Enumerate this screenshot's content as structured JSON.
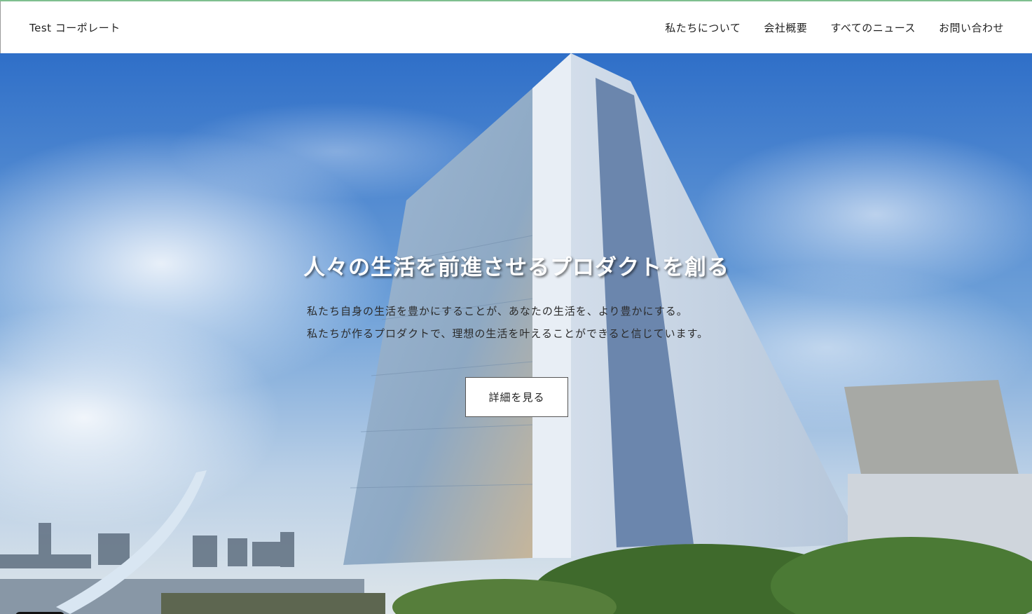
{
  "header": {
    "logo": "Test コーポレート",
    "nav": [
      {
        "label": "私たちについて"
      },
      {
        "label": "会社概要"
      },
      {
        "label": "すべてのニュース"
      },
      {
        "label": "お問い合わせ"
      }
    ]
  },
  "hero": {
    "title": "人々の生活を前進させるプロダクトを創る",
    "lines": [
      "私たち自身の生活を豊かにすることが、あなたの生活を、より豊かにする。",
      "私たちが作るプロダクトで、理想の生活を叶えることができると信じています。"
    ],
    "button_label": "詳細を見る"
  },
  "colors": {
    "sky": "#3d78c4",
    "header_bg": "#ffffff",
    "title_text": "#ffffff",
    "body_text": "#2b2b2b"
  }
}
